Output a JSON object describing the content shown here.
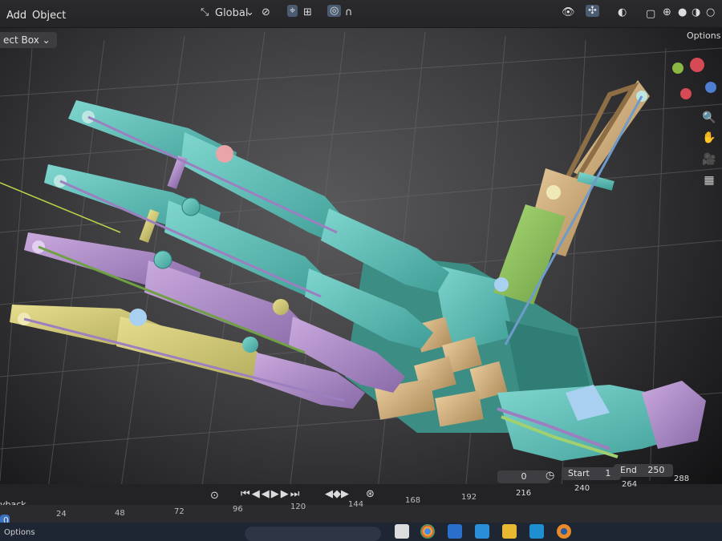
{
  "header": {
    "menu": [
      "Add",
      "Object"
    ],
    "transform_orientation": "Global",
    "select_mode": "ect Box",
    "options_label": "Options"
  },
  "timeline": {
    "playback_label": "yback",
    "current_frame": "0",
    "start_label": "Start",
    "start_value": "1",
    "end_label": "End",
    "end_value": "250",
    "top_ticks": [
      "216",
      "240",
      "264",
      "288"
    ],
    "bottom_ticks": [
      "24",
      "48",
      "72",
      "96",
      "120",
      "144",
      "168",
      "192"
    ],
    "options_label": "Options"
  },
  "icons": [
    "view-icon",
    "snap-icon",
    "proportional-edit-icon",
    "zoom-icon",
    "hand-icon",
    "camera-icon",
    "grid-icon",
    "chrome-icon",
    "edge-icon",
    "folder-icon",
    "blender-icon"
  ]
}
